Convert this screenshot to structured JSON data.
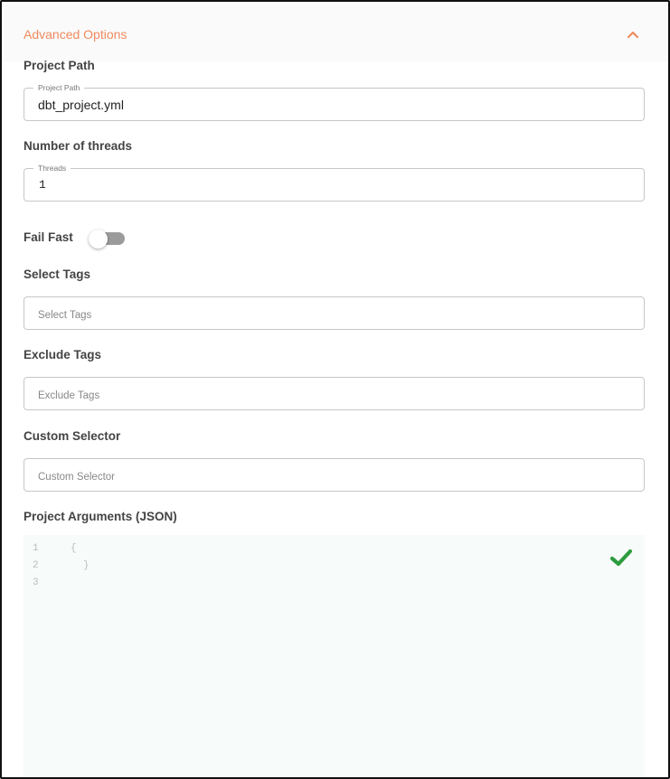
{
  "header": {
    "title": "Advanced Options",
    "collapse_icon": "chevron-up-icon"
  },
  "project_path": {
    "section_label": "Project Path",
    "field_label": "Project Path",
    "value": "dbt_project.yml"
  },
  "threads": {
    "section_label": "Number of threads",
    "field_label": "Threads",
    "value": "1"
  },
  "fail_fast": {
    "label": "Fail Fast",
    "enabled": false
  },
  "select_tags": {
    "section_label": "Select Tags",
    "placeholder": "Select Tags"
  },
  "exclude_tags": {
    "section_label": "Exclude Tags",
    "placeholder": "Exclude Tags"
  },
  "custom_selector": {
    "section_label": "Custom Selector",
    "placeholder": "Custom Selector"
  },
  "project_arguments": {
    "section_label": "Project Arguments (JSON)",
    "lines": [
      {
        "number": "1",
        "text": "{"
      },
      {
        "number": "2",
        "text": "}"
      },
      {
        "number": "3",
        "text": ""
      }
    ],
    "valid_icon": "checkmark-icon"
  },
  "colors": {
    "accent": "#ef8a5e",
    "valid": "#2e9c3e",
    "toggle_off": "#9b9b9b"
  }
}
